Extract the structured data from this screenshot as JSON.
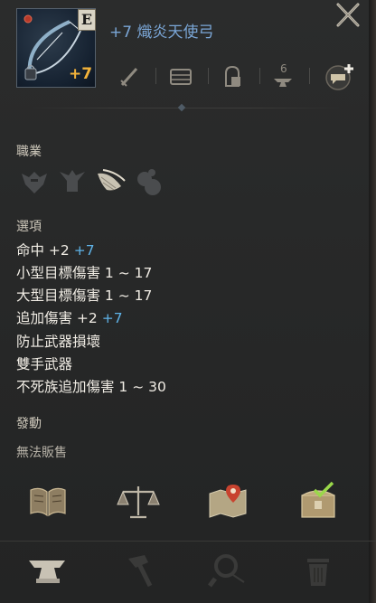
{
  "item": {
    "grade": "E",
    "enhance": "+7",
    "title": "+7 熾炎天使弓"
  },
  "sections": {
    "class_title": "職業",
    "options_title": "選項",
    "activate_title": "發動",
    "no_sell": "無法販售"
  },
  "stats": [
    {
      "label": "命中 +2",
      "bonus": "+7"
    },
    {
      "label": "小型目標傷害 1 ~ 17",
      "bonus": ""
    },
    {
      "label": "大型目標傷害 1 ~ 17",
      "bonus": ""
    },
    {
      "label": "追加傷害 +2",
      "bonus": "+7"
    },
    {
      "label": "防止武器損壞",
      "bonus": ""
    },
    {
      "label": "雙手武器",
      "bonus": ""
    },
    {
      "label": "不死族追加傷害 1 ~ 30",
      "bonus": ""
    }
  ],
  "icons": {
    "actions": [
      "sword-icon",
      "chest-icon",
      "crafting-icon",
      "anvil-6-icon",
      "chat-add-icon"
    ],
    "classes": [
      "knight-icon",
      "warrior-icon",
      "elf-wings-icon",
      "dwarf-icon"
    ],
    "bottom": [
      "book-icon",
      "scales-icon",
      "map-pin-icon",
      "treasure-chest-icon",
      "anvil-icon",
      "hammer-icon",
      "magnifier-icon",
      "trash-icon"
    ]
  },
  "colors": {
    "title": "#7aa6d6",
    "enhance": "#f2b23a",
    "bonus": "#5fb3e8"
  }
}
